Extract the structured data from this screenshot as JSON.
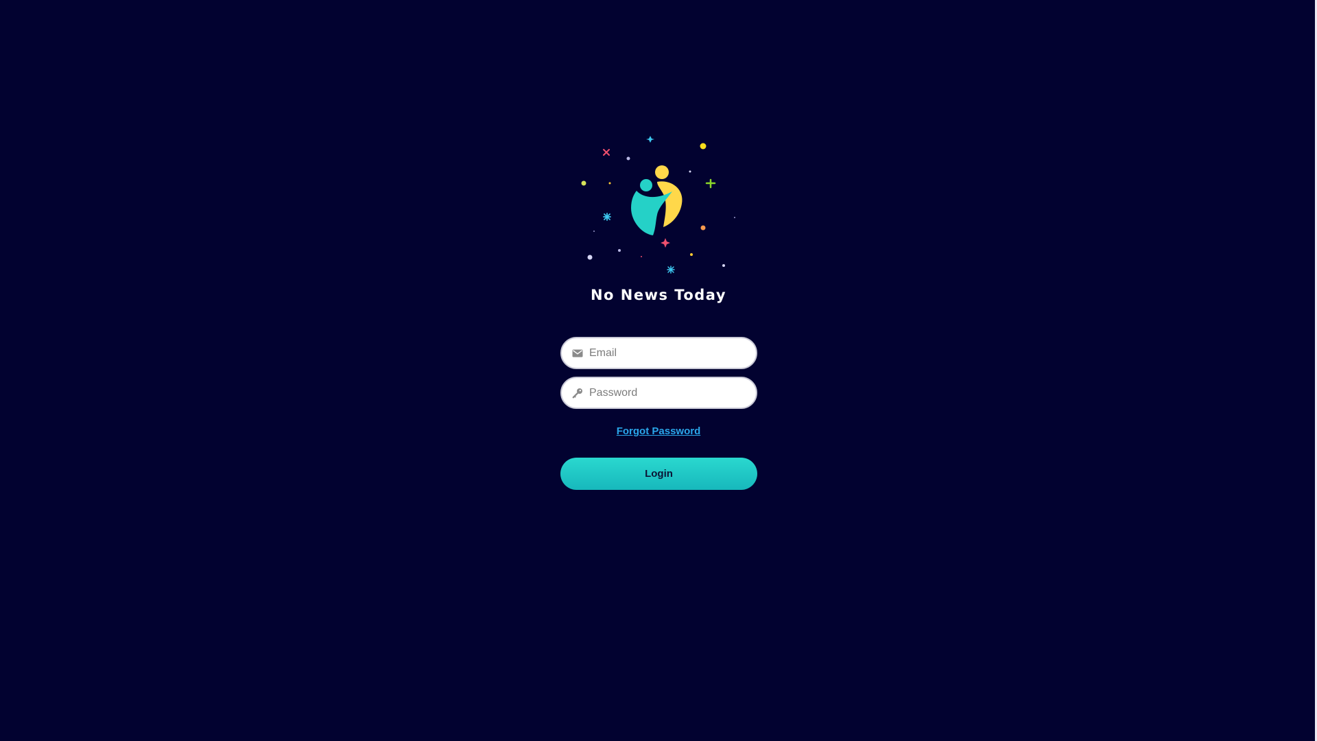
{
  "app": {
    "title": "No News Today"
  },
  "form": {
    "email": {
      "placeholder": "Email",
      "value": "",
      "icon": "mail-icon"
    },
    "password": {
      "placeholder": "Password",
      "value": "",
      "icon": "key-icon"
    },
    "forgot_label": "Forgot Password",
    "login_label": "Login"
  },
  "colors": {
    "background": "#020230",
    "accent": "#2ad8cf",
    "link": "#2aa6ea",
    "logo_yellow": "#ffd84a",
    "logo_teal": "#25d1c7"
  }
}
